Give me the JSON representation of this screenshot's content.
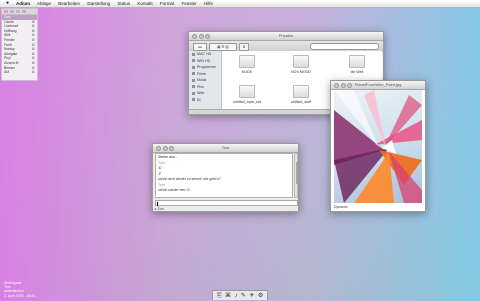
{
  "menubar": {
    "apple": "",
    "items": [
      "Adium",
      "Ablage",
      "Bearbeiten",
      "Darstellung",
      "Status",
      "Kontakt",
      "Format",
      "Fenster",
      "Hilfe"
    ]
  },
  "sidepanel": {
    "rows": [
      {
        "label": "Tom",
        "key": ""
      },
      {
        "label": "Cache",
        "key": "⌘"
      },
      {
        "label": "Lionhead",
        "key": "⌘"
      },
      {
        "label": "Hofflang",
        "key": "⌘"
      },
      {
        "label": "Wilk",
        "key": "⌘"
      },
      {
        "label": "Fender",
        "key": "⌘"
      },
      {
        "label": "Freifr",
        "key": "⌘"
      },
      {
        "label": "Norsky",
        "key": "⌘"
      },
      {
        "label": "Abnigale",
        "key": "⌘"
      },
      {
        "label": "Phyl",
        "key": "⌘"
      },
      {
        "label": "Alvarro M",
        "key": "⌘"
      },
      {
        "label": "Bender",
        "key": "⌘"
      },
      {
        "label": "AM",
        "key": "⌘"
      }
    ]
  },
  "finder": {
    "title": "Privates",
    "search_placeholder": "",
    "sidebar": [
      "MAC HD",
      "WIN HD",
      "Programme",
      "Filme",
      "Musik",
      "Pics",
      "Web",
      "Dl"
    ],
    "folders": [
      "NODE",
      "NO's MOOD",
      "die Welt",
      "untitled_topic_set",
      "untitled_stuff"
    ]
  },
  "preview": {
    "title": "PlanetFromWire_Paint.jpg",
    "caption": "Dynamic"
  },
  "chat": {
    "title": "Tom",
    "header": "Stefan aka...",
    "messages": [
      {
        "name": "Tom",
        "text": ":D"
      },
      {
        "name": "",
        "text": ":P"
      },
      {
        "name": "",
        "text": "schön dich wieder zu sehen! wie geht's?"
      },
      {
        "name": "Tom",
        "text": "schön wieder hier :D"
      }
    ],
    "tab_label": "Tom"
  },
  "info": [
    "Workspace",
    "Tom",
    "antireflection",
    "2. April 2009 - 18:41"
  ],
  "dock": [
    "🖹",
    "⌘",
    "♪",
    "✎",
    "✈",
    "⚙"
  ]
}
